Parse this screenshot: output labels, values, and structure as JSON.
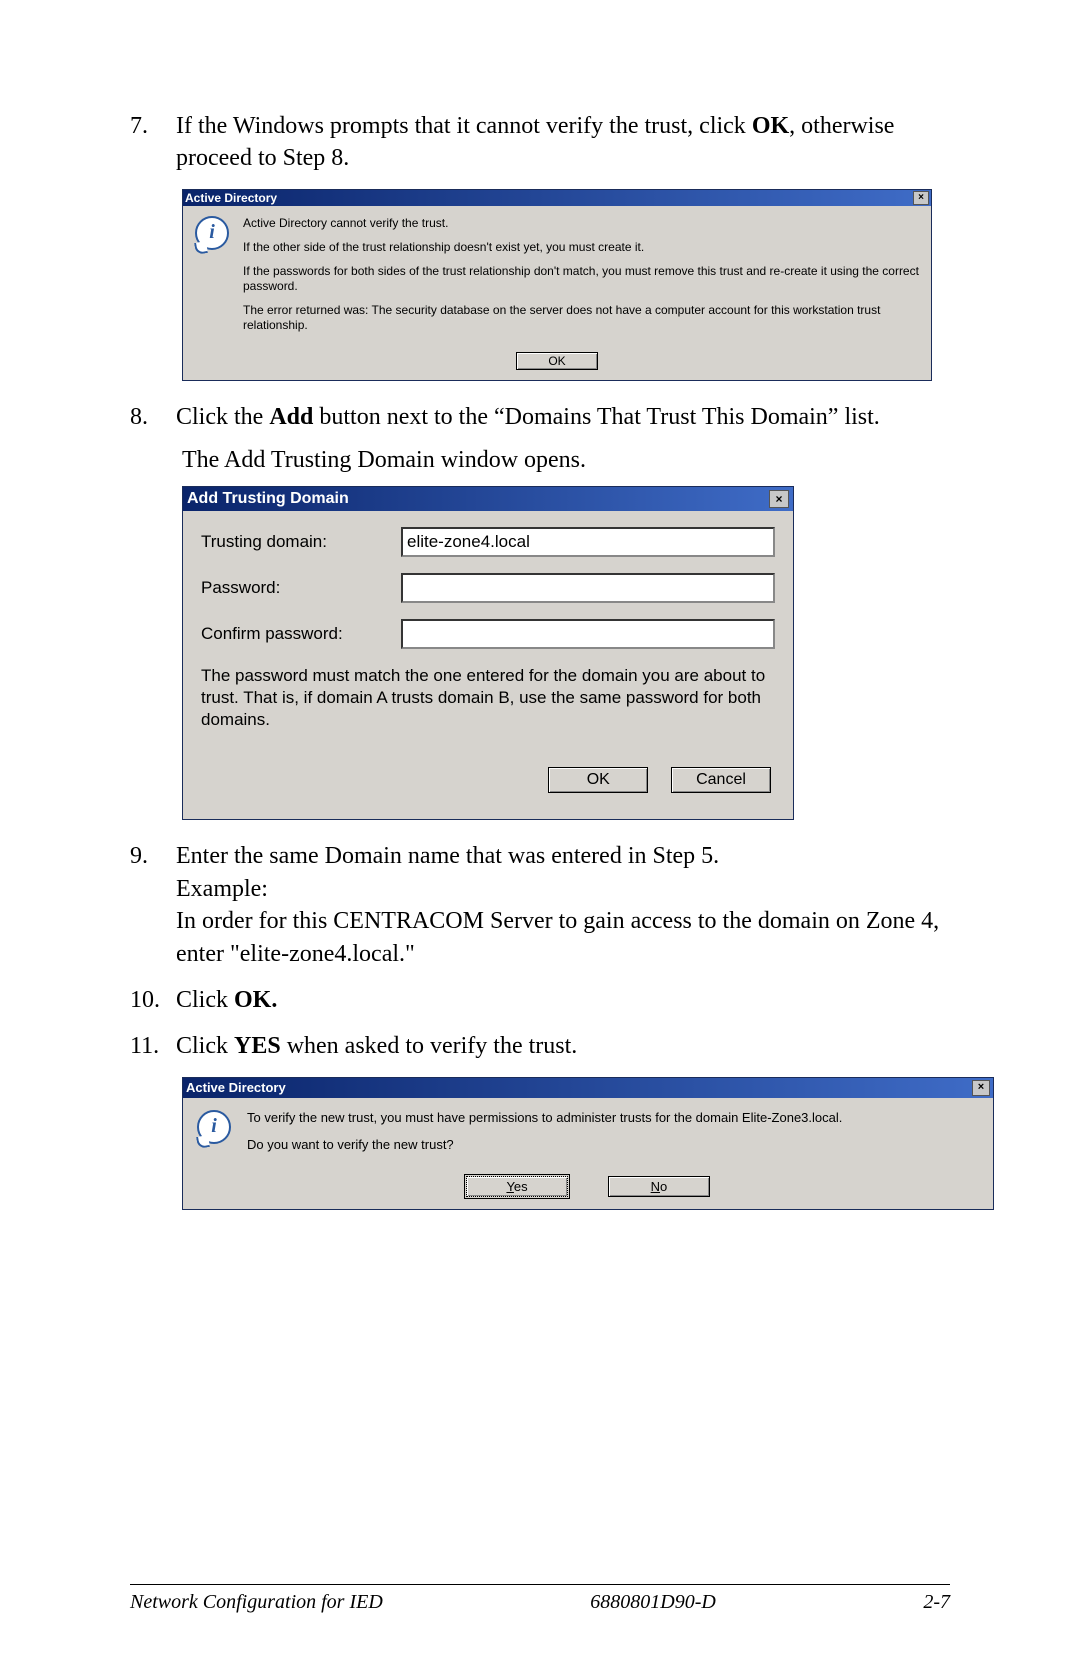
{
  "steps": {
    "s7_num": "7.",
    "s7_pre": "If the Windows prompts that it cannot verify the trust, click ",
    "s7_bold": "OK",
    "s7_post": ", otherwise proceed to Step 8.",
    "s8_num": "8.",
    "s8_pre": "Click the ",
    "s8_bold": "Add",
    "s8_post": " button next to the “Domains That Trust This Domain” list.",
    "s8_after": "The Add Trusting Domain window opens.",
    "s9_num": "9.",
    "s9_l1": "Enter the same Domain name that was entered in Step 5.",
    "s9_l2": "Example:",
    "s9_l3": "In order for this CENTRACOM Server to gain access to the domain on Zone 4, enter \"elite-zone4.local.\"",
    "s10_num": "10.",
    "s10_pre": "Click ",
    "s10_bold": "OK.",
    "s11_num": "11.",
    "s11_pre": "Click ",
    "s11_bold": "YES",
    "s11_post": " when asked to verify the trust."
  },
  "dialog1": {
    "title": "Active Directory",
    "p1": "Active Directory cannot verify the trust.",
    "p2": "If the other side of the trust relationship doesn't exist yet, you must create it.",
    "p3": "If the passwords for both sides of the trust relationship don't match, you must remove this trust and re-create it using the correct password.",
    "p4": "The error returned was: The security database on the server does not have a computer account for this workstation trust relationship.",
    "ok": "OK"
  },
  "dialog2": {
    "title": "Add Trusting Domain",
    "label1": "Trusting domain:",
    "value1": "elite-zone4.local",
    "label2": "Password:",
    "value2": "",
    "label3": "Confirm password:",
    "value3": "",
    "note": "The password must match the one entered for the domain you are about to trust. That is, if domain A trusts domain B, use the same password for both domains.",
    "ok": "OK",
    "cancel": "Cancel"
  },
  "dialog3": {
    "title": "Active Directory",
    "p1": "To verify the new trust, you must have permissions to administer trusts for the domain Elite-Zone3.local.",
    "p2": "Do you want to verify the new trust?",
    "yes": "Yes",
    "no": "No"
  },
  "footer": {
    "left": "Network Configuration for IED",
    "center": "6880801D90-D",
    "right": "2-7"
  }
}
